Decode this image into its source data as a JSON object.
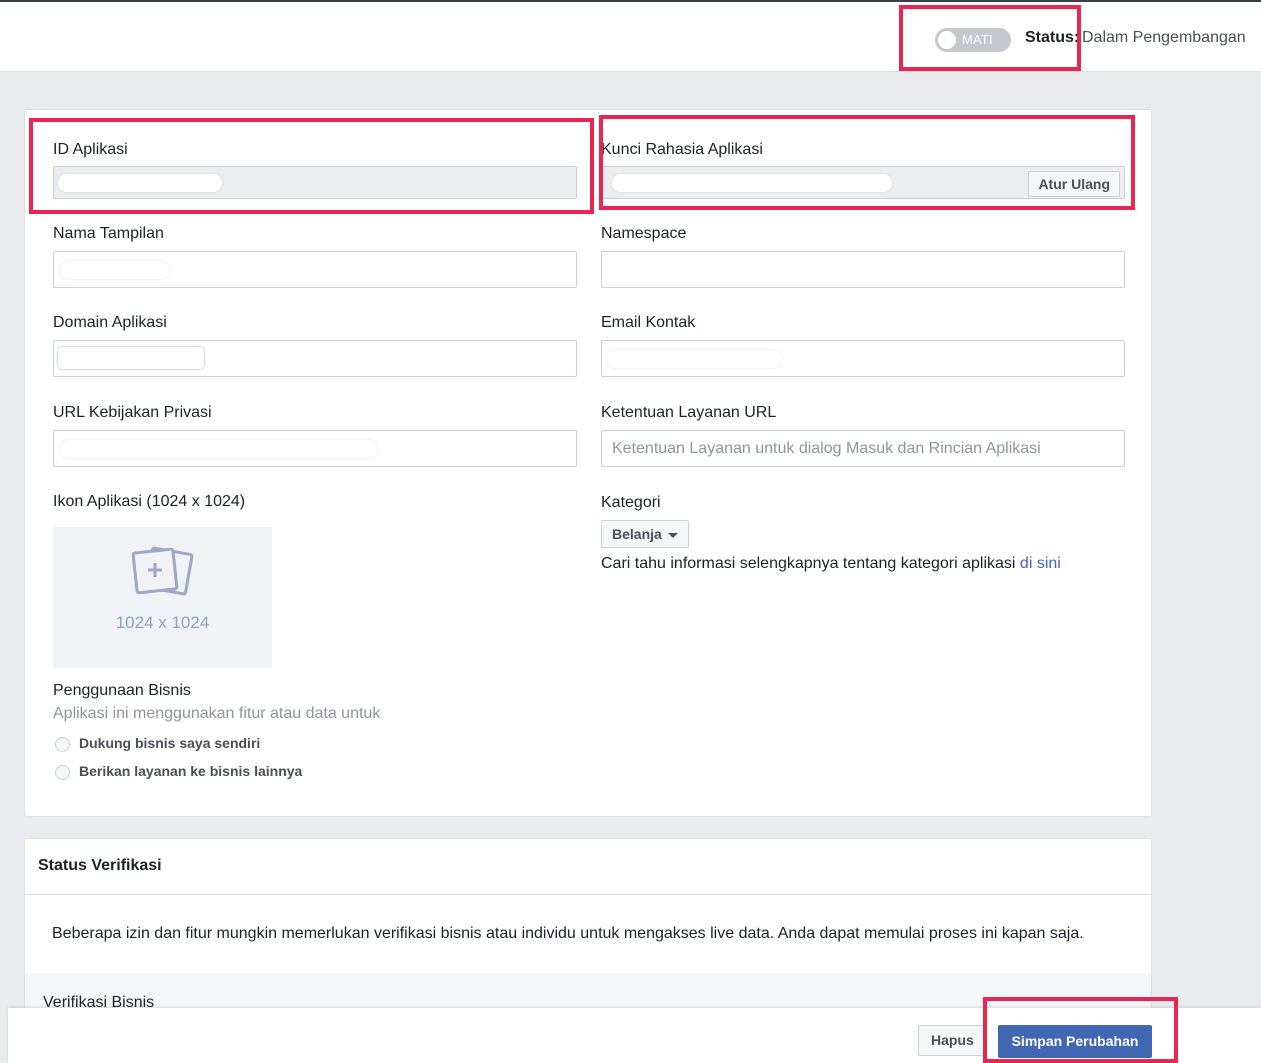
{
  "header": {
    "toggle_label": "MATI",
    "status_key": "Status:",
    "status_value": "Dalam Pengembangan"
  },
  "settings": {
    "app_id_label": "ID Aplikasi",
    "app_secret_label": "Kunci Rahasia Aplikasi",
    "reset_button": "Atur Ulang",
    "display_name_label": "Nama Tampilan",
    "namespace_label": "Namespace",
    "app_domain_label": "Domain Aplikasi",
    "contact_email_label": "Email Kontak",
    "privacy_url_label": "URL Kebijakan Privasi",
    "tos_url_label": "Ketentuan Layanan URL",
    "tos_url_placeholder": "Ketentuan Layanan untuk dialog Masuk dan Rincian Aplikasi",
    "app_icon_label": "Ikon Aplikasi (1024 x 1024)",
    "app_icon_size": "1024 x 1024",
    "category_label": "Kategori",
    "category_value": "Belanja",
    "category_help": "Cari tahu informasi selengkapnya tentang kategori aplikasi",
    "category_help_link": "di sini",
    "business_use_label": "Penggunaan Bisnis",
    "business_use_sub": "Aplikasi ini menggunakan fitur atau data untuk",
    "business_options": [
      "Dukung bisnis saya sendiri",
      "Berikan layanan ke bisnis lainnya"
    ]
  },
  "verification": {
    "title": "Status Verifikasi",
    "body": "Beberapa izin dan fitur mungkin memerlukan verifikasi bisnis atau individu untuk mengakses live data. Anda dapat memulai proses ini kapan saja.",
    "section_title": "Verifikasi Bisnis"
  },
  "footer": {
    "delete_button": "Hapus",
    "save_button": "Simpan Perubahan"
  },
  "colors": {
    "accent": "#4267b2",
    "highlight": "#e8264f"
  }
}
